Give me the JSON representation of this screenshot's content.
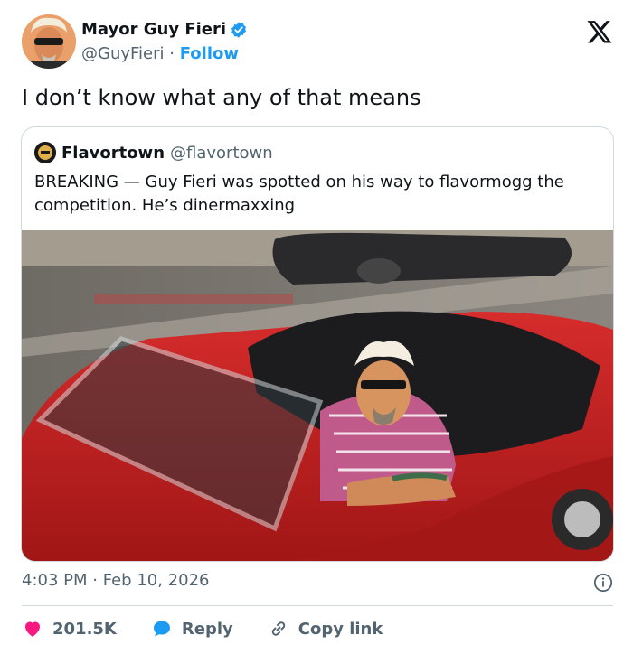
{
  "author": {
    "name": "Mayor Guy Fieri",
    "handle": "@GuyFieri",
    "separator": "·",
    "follow_label": "Follow"
  },
  "tweet": {
    "text": "I don’t know what any of that means",
    "time": "4:03 PM",
    "date_separator": "·",
    "date": "Feb 10, 2026"
  },
  "quote": {
    "name": "Flavortown",
    "handle": "@flavortown",
    "text": "BREAKING — Guy Fieri was spotted on his way to flavormogg the competition. He’s dinermaxxing"
  },
  "actions": {
    "likes": "201.5K",
    "reply_label": "Reply",
    "copy_label": "Copy link"
  },
  "colors": {
    "accent": "#1d9bf0",
    "like": "#f91880",
    "text": "#0f1419",
    "muted": "#536471",
    "border": "#cfd9de"
  },
  "icons": [
    "verified-badge-icon",
    "x-logo-icon",
    "info-icon",
    "heart-icon",
    "reply-bubble-icon",
    "link-icon"
  ]
}
